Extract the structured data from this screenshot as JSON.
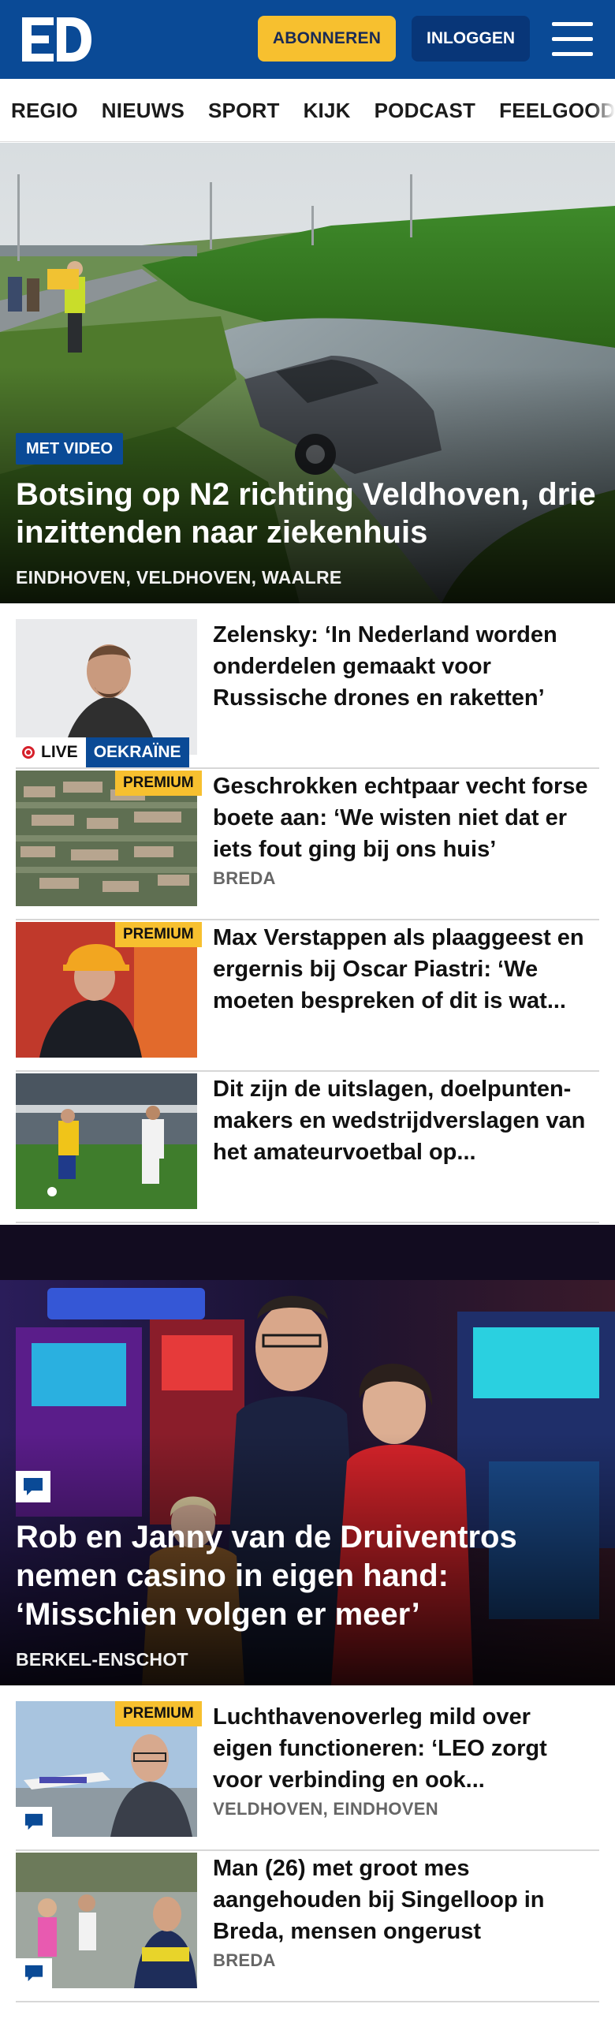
{
  "header": {
    "logo": "ED",
    "subscribe_label": "ABONNEREN",
    "login_label": "INLOGGEN"
  },
  "nav": {
    "items": [
      "REGIO",
      "NIEUWS",
      "SPORT",
      "KIJK",
      "PODCAST",
      "FEELGOOD"
    ]
  },
  "hero": {
    "tag": "MET VIDEO",
    "title": "Botsing op N2 richting Veldhoven, drie inzittenden naar ziekenhuis",
    "location": "EINDHOVEN, VELDHOVEN, WAALRE"
  },
  "articles": [
    {
      "title": "Zelensky: ‘In Nederland worden onderdelen gemaakt voor Russische drones en raketten’",
      "live_label": "LIVE",
      "topic": "OEKRAÏNE"
    },
    {
      "title": "Geschrokken echtpaar vecht forse boete aan: ‘We wisten niet dat er iets fout ging bij ons huis’",
      "badge": "PREMIUM",
      "location": "BREDA"
    },
    {
      "title": "Max Verstappen als plaaggeest en ergernis bij Oscar Piastri: ‘We moeten bespreken of dit is wat...",
      "badge": "PREMIUM"
    },
    {
      "title": "Dit zijn de uitslagen, doelpunten­makers en wedstrijdverslagen van het amateurvoetbal op..."
    }
  ],
  "feature": {
    "title": "Rob en Janny van de Druiventros nemen casino in eigen hand: ‘Misschien volgen er meer’",
    "location": "BERKEL-ENSCHOT"
  },
  "articles_bottom": [
    {
      "title": "Luchthavenoverleg mild over eigen functioneren: ‘LEO zorgt voor verbinding en ook...",
      "badge": "PREMIUM",
      "location": "VELDHOVEN, EINDHOVEN"
    },
    {
      "title": "Man (26) met groot mes aangehouden bij Singelloop in Breda, mensen ongerust",
      "location": "BREDA"
    }
  ],
  "colors": {
    "brand_blue": "#0a4a96",
    "subscribe_yellow": "#f7c02f",
    "live_red": "#d6202a"
  }
}
